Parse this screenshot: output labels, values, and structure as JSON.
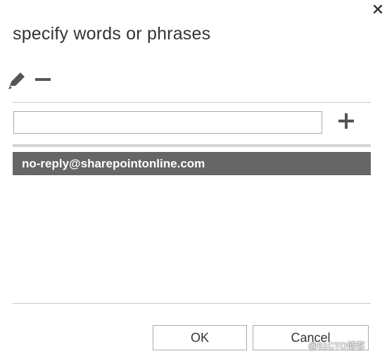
{
  "dialog": {
    "title": "specify words or phrases",
    "close_icon": "close-icon"
  },
  "toolbar": {
    "edit_icon": "pencil-icon",
    "remove_icon": "minus-icon"
  },
  "entry": {
    "value": "",
    "placeholder": "",
    "add_icon": "plus-icon"
  },
  "list": {
    "items": [
      {
        "label": "no-reply@sharepointonline.com",
        "selected": true
      }
    ]
  },
  "footer": {
    "ok_label": "OK",
    "cancel_label": "Cancel"
  },
  "watermark": {
    "text": "@51CTO博客"
  },
  "colors": {
    "selected_row": "#666666",
    "icon": "#555555",
    "divider": "#c8c8c8"
  }
}
